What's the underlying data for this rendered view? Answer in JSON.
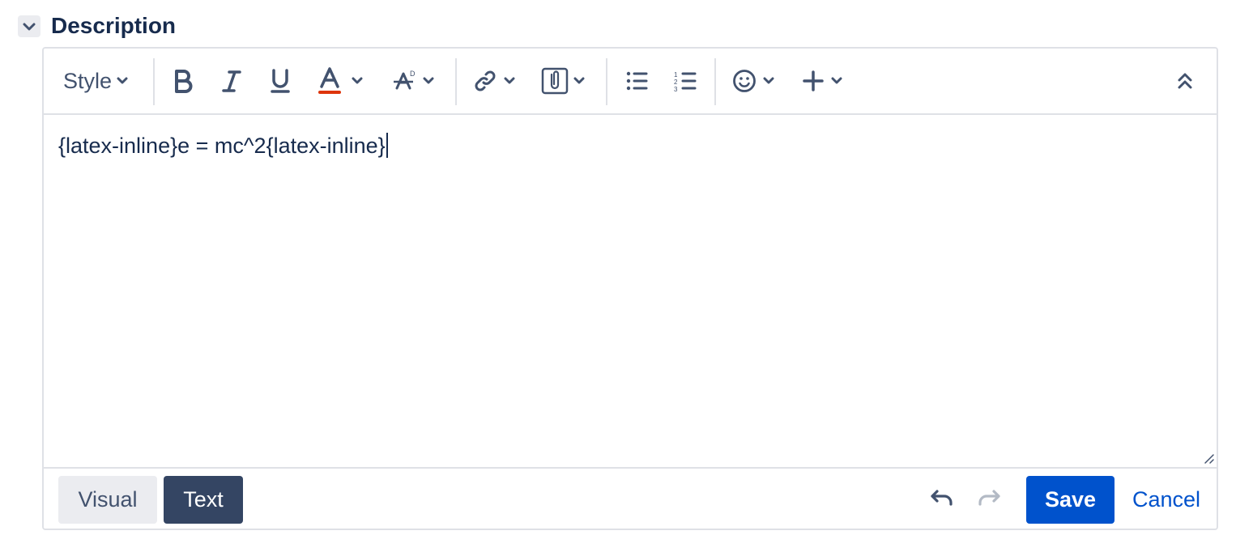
{
  "section": {
    "title": "Description",
    "toggle_icon": "chevron-down-icon"
  },
  "toolbar": {
    "style_label": "Style",
    "items": [
      "bold-icon",
      "italic-icon",
      "underline-icon",
      "text-color-icon",
      "text-format-icon",
      "link-icon",
      "attachment-icon",
      "bullet-list-icon",
      "numbered-list-icon",
      "emoji-icon",
      "insert-plus-icon",
      "collapse-toolbar-icon"
    ],
    "text_color": "#de350b"
  },
  "editor": {
    "content": "{latex-inline}e = mc^2{latex-inline}"
  },
  "footer": {
    "visual_label": "Visual",
    "text_label": "Text",
    "save_label": "Save",
    "cancel_label": "Cancel"
  },
  "colors": {
    "primary": "#0052cc",
    "active_mode": "#344563",
    "text": "#172b4d",
    "icon": "#42526e",
    "border": "#dfe1e6"
  }
}
